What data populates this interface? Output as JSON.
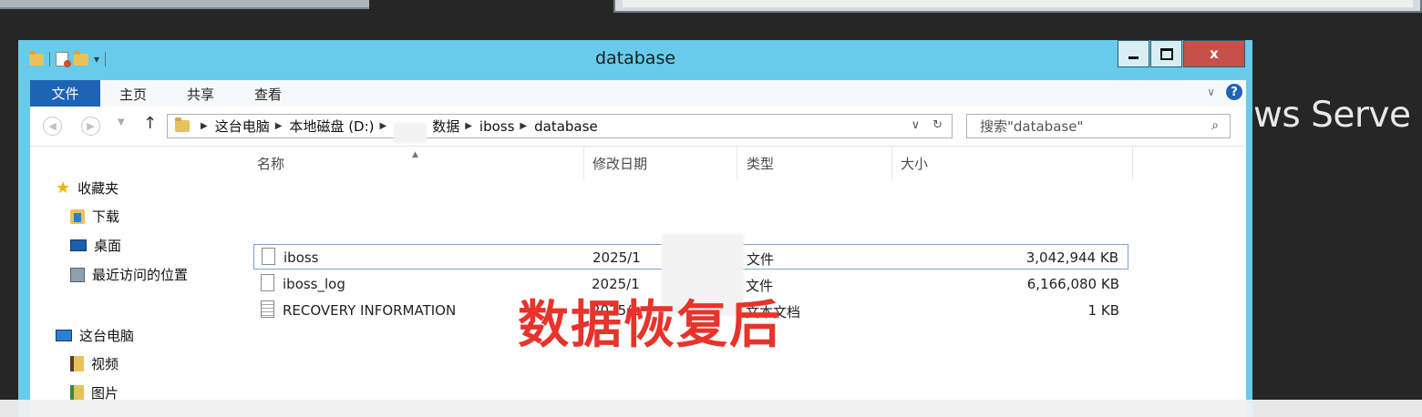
{
  "desktop": {
    "background_text": "ws Serve"
  },
  "window": {
    "title": "database",
    "close_glyph": "x",
    "ribbon_tabs": [
      "文件",
      "主页",
      "共享",
      "查看"
    ],
    "help_glyph": "?",
    "collapse_glyph": "∨"
  },
  "address": {
    "crumbs": [
      "这台电脑",
      "本地磁盘 (D:)",
      "",
      "数据",
      "iboss",
      "database"
    ]
  },
  "search": {
    "placeholder": "搜索\"database\""
  },
  "sidebar": {
    "favorites": {
      "label": "收藏夹",
      "items": [
        "下载",
        "桌面",
        "最近访问的位置"
      ]
    },
    "this_pc": {
      "label": "这台电脑",
      "items": [
        "视频",
        "图片"
      ]
    }
  },
  "columns": {
    "name": "名称",
    "modified": "修改日期",
    "type": "类型",
    "size": "大小"
  },
  "files": [
    {
      "name": "iboss",
      "modified": "2025/1",
      "type": "文件",
      "size": "3,042,944 KB",
      "selected": true
    },
    {
      "name": "iboss_log",
      "modified": "2025/1",
      "type": "文件",
      "size": "6,166,080 KB",
      "selected": false
    },
    {
      "name": "RECOVERY INFORMATION",
      "modified": "2025/1",
      "type": "文本文档",
      "size": "1 KB",
      "selected": false
    }
  ],
  "overlay": {
    "caption": "数据恢复后",
    "color": "#e8332b"
  },
  "colors": {
    "titlebar": "#67cbe9",
    "file_tab": "#1f63b5",
    "close": "#c7514a"
  }
}
